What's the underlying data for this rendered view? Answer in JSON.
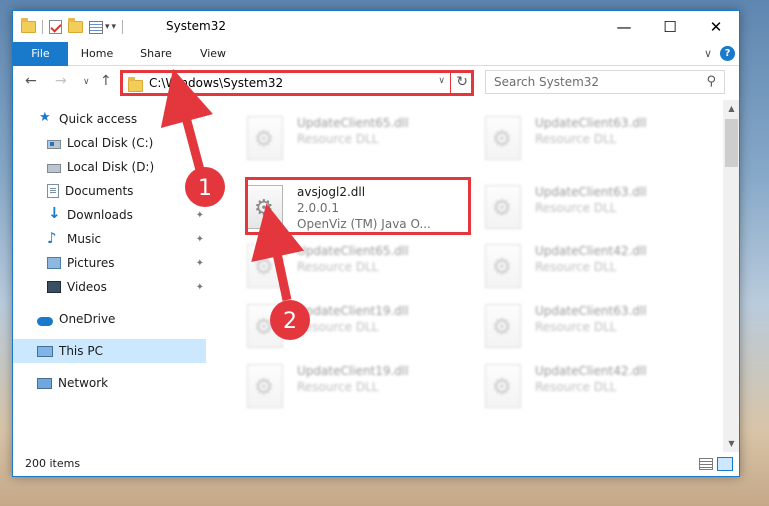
{
  "window": {
    "title": "System32",
    "controls": {
      "minimize": "—",
      "maximize": "☐",
      "close": "✕"
    }
  },
  "ribbon": {
    "tabs": [
      {
        "label": "File"
      },
      {
        "label": "Home"
      },
      {
        "label": "Share"
      },
      {
        "label": "View"
      }
    ]
  },
  "address": {
    "path": "C:\\Windows\\System32"
  },
  "search": {
    "placeholder": "Search System32"
  },
  "sidebar": {
    "items": [
      {
        "label": "Quick access",
        "icon": "star-icon"
      },
      {
        "label": "Local Disk (C:)",
        "icon": "drive-icon"
      },
      {
        "label": "Local Disk (D:)",
        "icon": "drive-icon"
      },
      {
        "label": "Documents",
        "icon": "documents-icon",
        "pinned": true
      },
      {
        "label": "Downloads",
        "icon": "downloads-icon",
        "pinned": true
      },
      {
        "label": "Music",
        "icon": "music-icon",
        "pinned": true
      },
      {
        "label": "Pictures",
        "icon": "pictures-icon",
        "pinned": true
      },
      {
        "label": "Videos",
        "icon": "videos-icon",
        "pinned": true
      },
      {
        "label": "OneDrive",
        "icon": "cloud-icon"
      },
      {
        "label": "This PC",
        "icon": "computer-icon",
        "selected": true
      },
      {
        "label": "Network",
        "icon": "network-icon"
      }
    ]
  },
  "files": {
    "left": [
      {
        "name": "UpdateClient65.dll",
        "type": "Resource DLL"
      },
      {
        "name": "avsjogl2.dll",
        "version": "2.0.0.1",
        "description": "OpenViz (TM) Java O..."
      },
      {
        "name": "UpdateClient65.dll",
        "type": "Resource DLL"
      },
      {
        "name": "UpdateClient19.dll",
        "type": "Resource DLL"
      },
      {
        "name": "UpdateClient19.dll",
        "type": "Resource DLL"
      }
    ],
    "right": [
      {
        "name": "UpdateClient63.dll",
        "type": "Resource DLL"
      },
      {
        "name": "UpdateClient63.dll",
        "type": "Resource DLL"
      },
      {
        "name": "UpdateClient42.dll",
        "type": "Resource DLL"
      },
      {
        "name": "UpdateClient63.dll",
        "type": "Resource DLL"
      },
      {
        "name": "UpdateClient42.dll",
        "type": "Resource DLL"
      }
    ]
  },
  "status": {
    "item_count": "200 items"
  },
  "annotations": {
    "step1": "1",
    "step2": "2",
    "color": "#e3363d"
  }
}
